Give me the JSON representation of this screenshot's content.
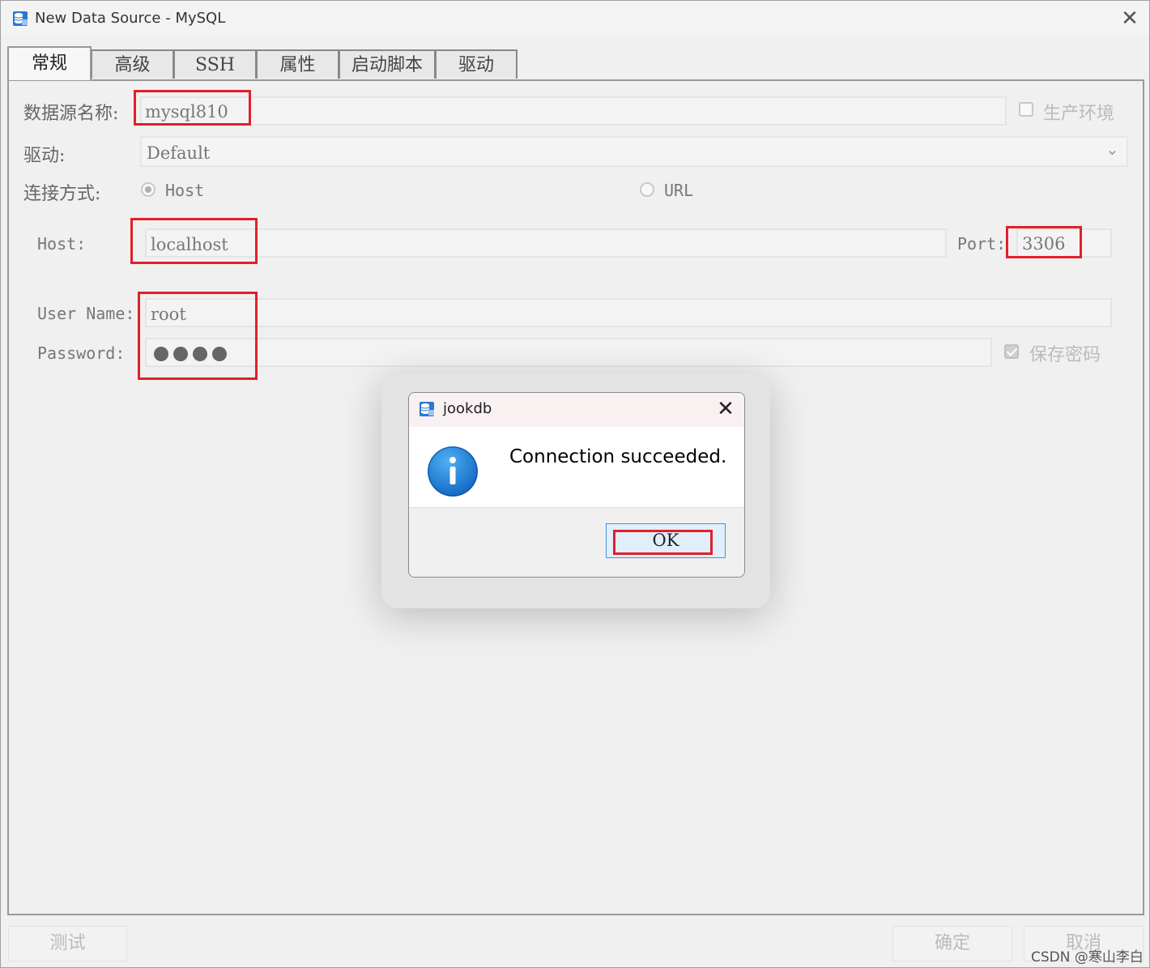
{
  "window": {
    "title": "New Data Source - MySQL",
    "close_glyph": "✕"
  },
  "tabs": [
    {
      "label": "常规",
      "active": true
    },
    {
      "label": "高级",
      "active": false
    },
    {
      "label": "SSH",
      "active": false
    },
    {
      "label": "属性",
      "active": false
    },
    {
      "label": "启动脚本",
      "active": false
    },
    {
      "label": "驱动",
      "active": false
    }
  ],
  "form": {
    "datasource_name_label": "数据源名称:",
    "datasource_name_value": "mysql810",
    "production_label": "生产环境",
    "production_checked": false,
    "driver_label": "驱动:",
    "driver_value": "Default",
    "dropdown_glyph": "⌄",
    "conn_method_label": "连接方式:",
    "conn_host_option": "Host",
    "conn_url_option": "URL",
    "conn_selected": "Host",
    "host_label": "Host:",
    "host_value": "localhost",
    "port_label": "Port:",
    "port_value": "3306",
    "username_label": "User Name:",
    "username_value": "root",
    "password_label": "Password:",
    "password_length": 4,
    "save_password_label": "保存密码",
    "save_password_checked": true
  },
  "buttons": {
    "test": "测试",
    "confirm": "确定",
    "cancel": "取消"
  },
  "dialog": {
    "title": "jookdb",
    "message": "Connection succeeded.",
    "ok_label": "OK",
    "close_glyph": "✕",
    "icon": "info-icon"
  },
  "watermark": "CSDN @寒山李白",
  "colors": {
    "highlight_red": "#e0202a",
    "ok_border": "#4d8fd8",
    "info_blue": "#1a7fd6"
  }
}
